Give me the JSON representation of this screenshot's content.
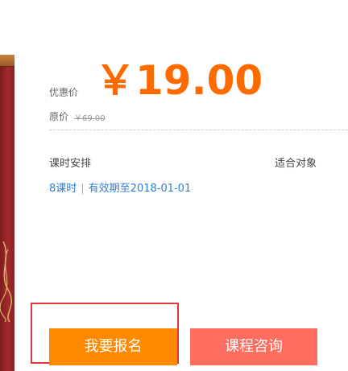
{
  "price": {
    "label": "优惠价",
    "value": "￥19.00",
    "original_label": "原价",
    "original_value": "￥69.00"
  },
  "course": {
    "schedule_label": "课时安排",
    "audience_label": "适合对象",
    "lessons": "8课时",
    "separator": "|",
    "validity": "有效期至2018-01-01"
  },
  "actions": {
    "enroll_label": "我要报名",
    "consult_label": "课程咨询"
  },
  "colors": {
    "price": "#ff6a00",
    "enroll_button": "#ff8a00",
    "consult_button": "#ff6d5e",
    "link_text": "#2f7fd1",
    "highlight_border": "#e4393c"
  }
}
